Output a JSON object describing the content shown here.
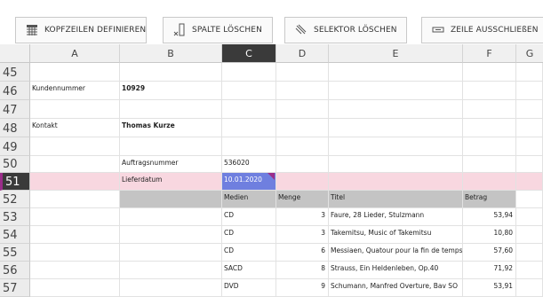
{
  "toolbar": {
    "buttons": [
      {
        "label": "KOPFZEILEN DEFINIEREN",
        "icon": "table-header-icon"
      },
      {
        "label": "SPALTE LÖSCHEN",
        "icon": "delete-column-icon"
      },
      {
        "label": "SELEKTOR LÖSCHEN",
        "icon": "eraser-icon"
      },
      {
        "label": "ZEILE AUSSCHLIEßEN",
        "icon": "exclude-row-icon"
      }
    ]
  },
  "columns": [
    "A",
    "B",
    "C",
    "D",
    "E",
    "F",
    "G"
  ],
  "selected_column": "C",
  "rows": [
    "45",
    "46",
    "47",
    "48",
    "49",
    "50",
    "51",
    "52",
    "53",
    "54",
    "55",
    "56",
    "57"
  ],
  "selected_row": "51",
  "cells": {
    "r46": {
      "a": "Kundennummer",
      "b": "10929"
    },
    "r48": {
      "a": "Kontakt",
      "b": "Thomas Kurze"
    },
    "r50": {
      "b": "Auftragsnummer",
      "c": "536020"
    },
    "r51": {
      "b": "Lieferdatum",
      "c": "10.01.2020"
    },
    "r52": {
      "c": "Medien",
      "d": "Menge",
      "e": "Titel",
      "f": "Betrag"
    },
    "r53": {
      "c": "CD",
      "d": "3",
      "e": "Faure, 28 Lieder, Stulzmann",
      "f": "53,94"
    },
    "r54": {
      "c": "CD",
      "d": "3",
      "e": "Takemitsu, Music of Takemitsu",
      "f": "10,80"
    },
    "r55": {
      "c": "CD",
      "d": "6",
      "e": "Messiaen, Quatour pour la fin de temps",
      "f": "57,60"
    },
    "r56": {
      "c": "SACD",
      "d": "8",
      "e": "Strauss, Ein Heldenleben, Op.40",
      "f": "71,92"
    },
    "r57": {
      "c": "DVD",
      "d": "9",
      "e": "Schumann, Manfred Overture, Bav SO",
      "f": "53,91"
    }
  },
  "colors": {
    "selected_header": "#3a3a3a",
    "highlight_row": "#f8d7e0",
    "table_header": "#c4c4c4",
    "selected_cell": "#6f7fdf",
    "marker": "#9b2d8a"
  }
}
